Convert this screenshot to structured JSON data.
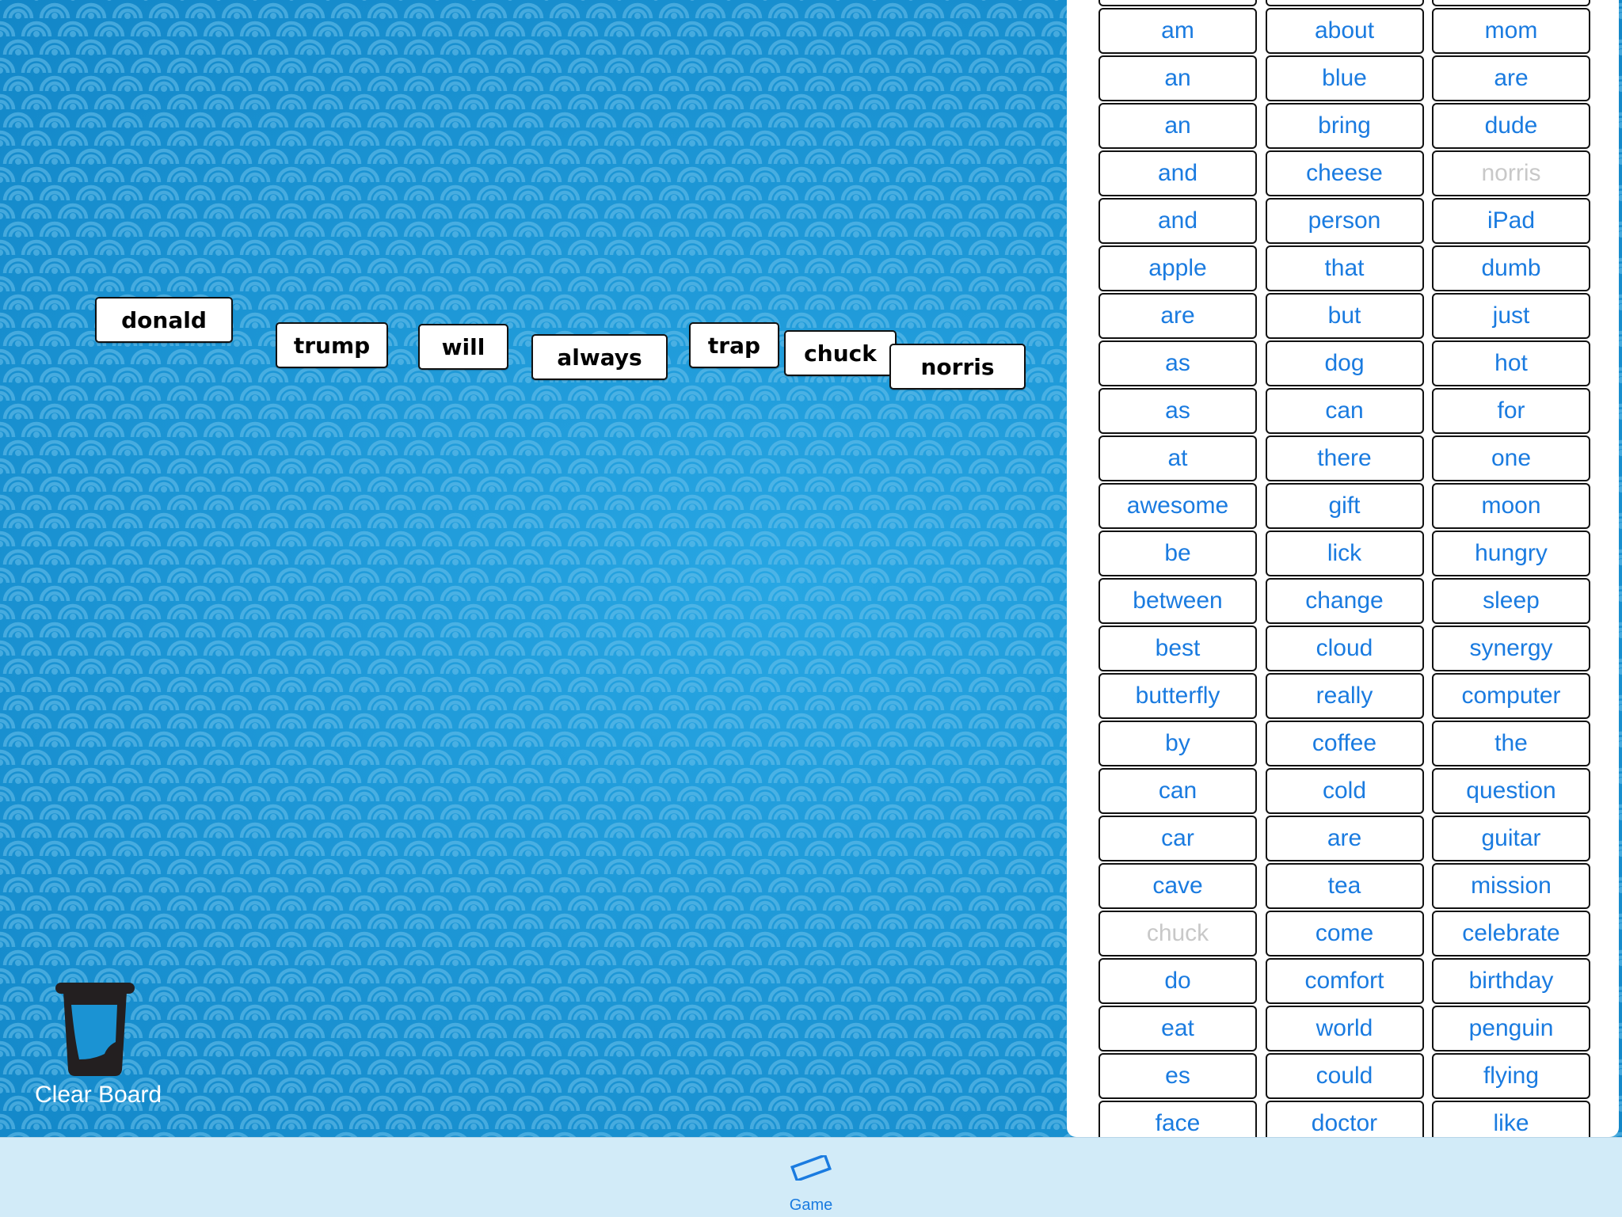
{
  "colors": {
    "board_background": "#1b93d3",
    "pattern": "#5cb6e6",
    "word_text": "#1a7be0",
    "word_text_used": "#c8c8c8",
    "tile_border": "#111111",
    "tabbar_background": "#d2ebf8",
    "tab_active": "#1a7be0"
  },
  "board": {
    "tiles": [
      {
        "word": "donald"
      },
      {
        "word": "trump"
      },
      {
        "word": "will"
      },
      {
        "word": "always"
      },
      {
        "word": "trap"
      },
      {
        "word": "chuck"
      },
      {
        "word": "norris"
      }
    ],
    "clear_board": {
      "label": "Clear Board",
      "icon": "trash-can-icon"
    }
  },
  "word_bank": {
    "columns": [
      [
        "am",
        "an",
        "an",
        "and",
        "and",
        "apple",
        "are",
        "as",
        "as",
        "at",
        "awesome",
        "be",
        "between",
        "best",
        "butterfly",
        "by",
        "can",
        "car",
        "cave",
        "chuck",
        "do",
        "eat",
        "es",
        "face"
      ],
      [
        "about",
        "blue",
        "bring",
        "cheese",
        "person",
        "that",
        "but",
        "dog",
        "can",
        "there",
        "gift",
        "lick",
        "change",
        "cloud",
        "really",
        "coffee",
        "cold",
        "are",
        "tea",
        "come",
        "comfort",
        "world",
        "could",
        "doctor"
      ],
      [
        "mom",
        "are",
        "dude",
        "norris",
        "iPad",
        "dumb",
        "just",
        "hot",
        "for",
        "one",
        "moon",
        "hungry",
        "sleep",
        "synergy",
        "computer",
        "the",
        "question",
        "guitar",
        "mission",
        "celebrate",
        "birthday",
        "penguin",
        "flying",
        "like"
      ]
    ],
    "used": [
      {
        "column": 0,
        "row": 19,
        "word": "chuck"
      },
      {
        "column": 2,
        "row": 3,
        "word": "norris"
      }
    ]
  },
  "tabbar": {
    "tabs": [
      {
        "label": "Game",
        "icon": "game-tile-icon",
        "active": true
      }
    ]
  }
}
